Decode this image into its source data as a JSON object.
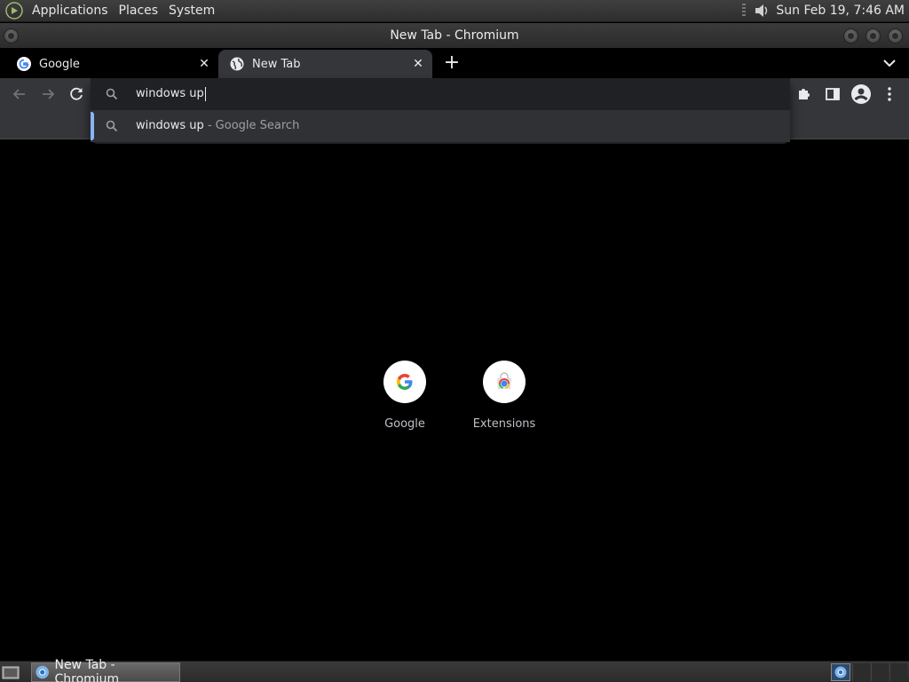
{
  "top_panel": {
    "menus": [
      "Applications",
      "Places",
      "System"
    ],
    "clock": "Sun Feb 19,  7:46 AM"
  },
  "window": {
    "title": "New Tab - Chromium"
  },
  "tabs": [
    {
      "title": "Google",
      "favicon": "google-g-icon",
      "active": false
    },
    {
      "title": "New Tab",
      "favicon": "globe-icon",
      "active": true
    }
  ],
  "toolbar": {
    "icons": [
      "back-arrow-icon",
      "forward-arrow-icon",
      "reload-icon",
      "extensions-puzzle-icon",
      "side-panel-icon",
      "profile-avatar-icon",
      "more-vert-icon"
    ]
  },
  "omnibox": {
    "value": "windows up",
    "suggestions": [
      {
        "text": "windows up",
        "description": " - Google Search",
        "icon": "search-icon",
        "selected": true
      }
    ]
  },
  "shortcuts": [
    {
      "label": "Google",
      "icon": "google-g-icon"
    },
    {
      "label": "Extensions",
      "icon": "chrome-web-store-icon"
    }
  ],
  "taskbar": {
    "tasks": [
      {
        "label": "New Tab - Chromium",
        "icon": "chromium-icon"
      }
    ]
  },
  "colors": {
    "accent": "#8ab4f8",
    "toolbar": "#35363a",
    "omnibox_bg": "#202124",
    "suggestion_bg": "#303134",
    "page_bg": "#000000"
  }
}
